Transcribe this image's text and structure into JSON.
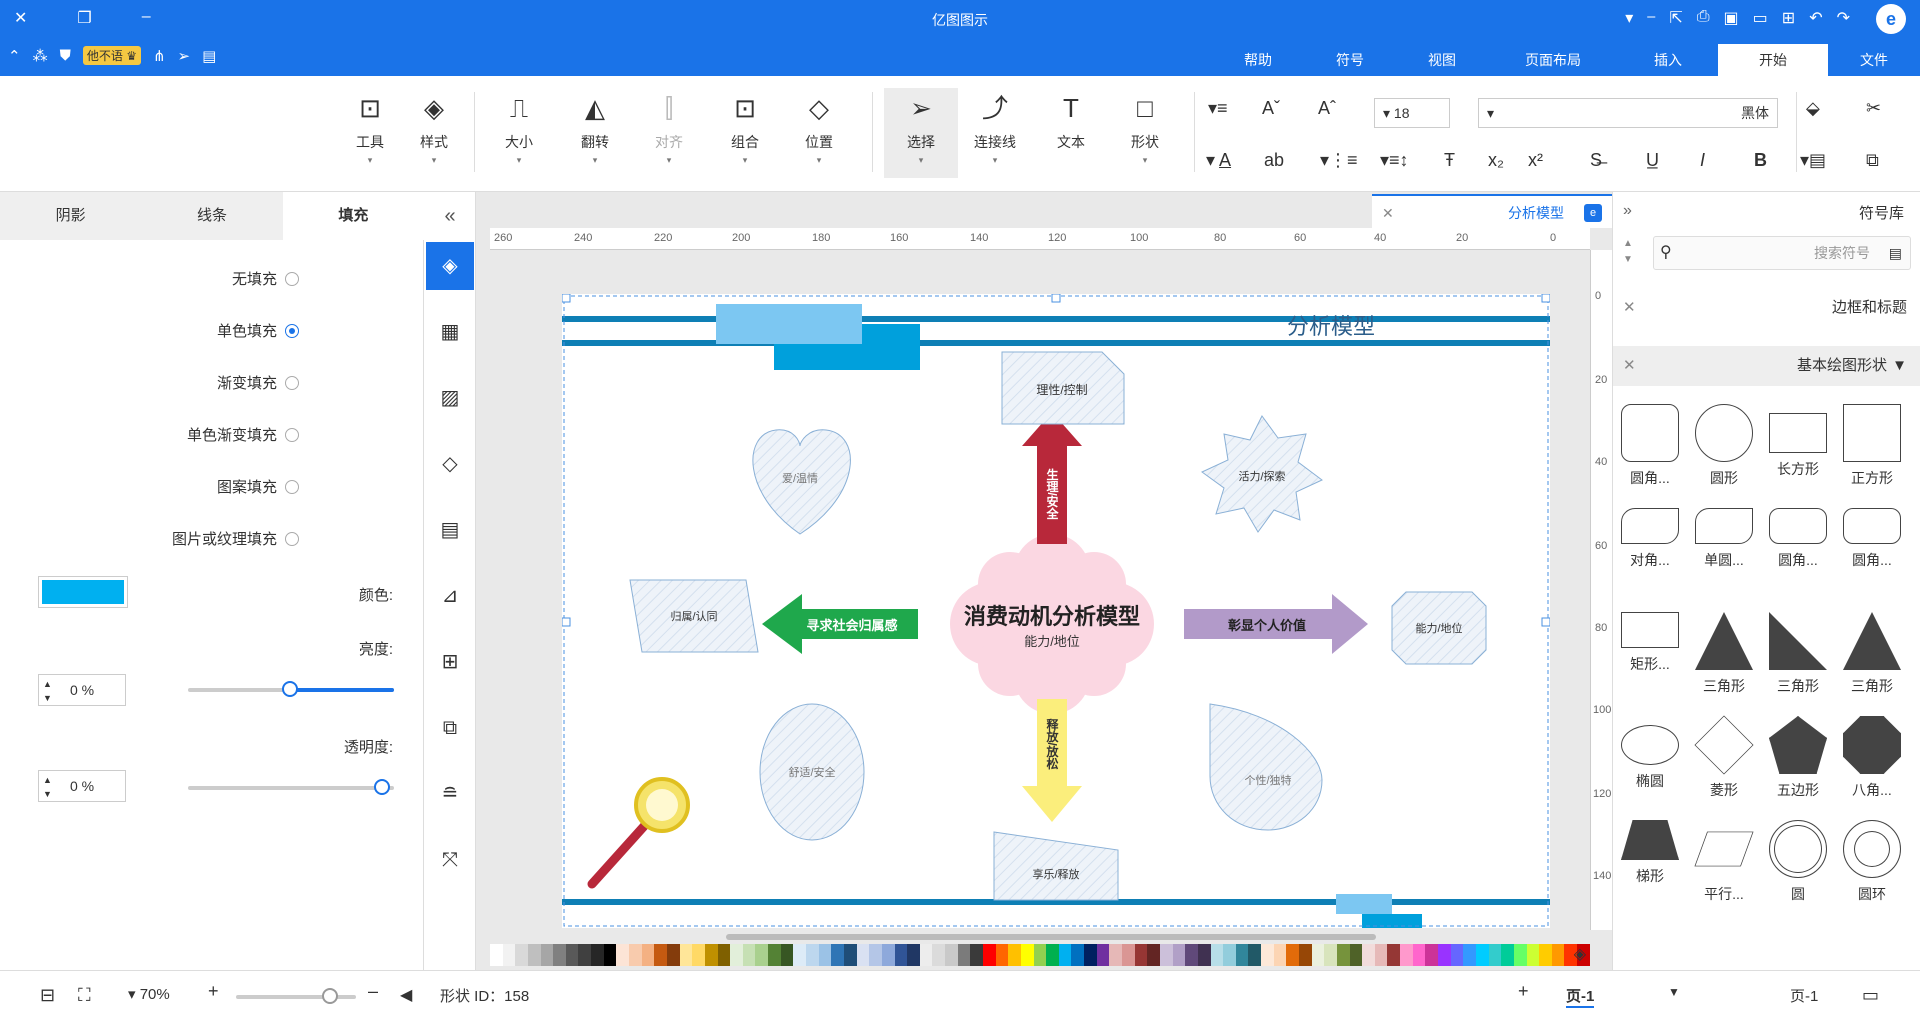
{
  "app": {
    "title": "亿图图示"
  },
  "quickaccess": {
    "user_label": "他不语"
  },
  "menu": {
    "tabs": [
      "文件",
      "开始",
      "插入",
      "页面布局",
      "视图",
      "符号",
      "帮助"
    ],
    "active": "开始"
  },
  "ribbon": {
    "buttons": {
      "tools": "工具",
      "style": "样式",
      "size": "大小",
      "flip": "翻转",
      "align": "对齐",
      "group": "组合",
      "position": "位置",
      "select": "选择",
      "connector": "连接线",
      "text": "文本",
      "shape": "形状"
    },
    "font_size": "18",
    "font_name": "黑体"
  },
  "left_panel": {
    "tabs": [
      "填充",
      "线条",
      "阴影"
    ],
    "active_tab": "填充",
    "fill_options": [
      "无填充",
      "单色填充",
      "渐变填充",
      "单色渐变填充",
      "图案填充",
      "图片或纹理填充"
    ],
    "selected_fill": "单色填充",
    "color_label": "颜色:",
    "fill_color": "#00b0f0",
    "brightness_label": "亮度:",
    "brightness_value": "0 %",
    "transparency_label": "透明度:",
    "transparency_value": "0 %"
  },
  "document": {
    "tab_title": "分析模型"
  },
  "diagram": {
    "title": "分析模型",
    "center_title": "消费动机分析模型",
    "center_sub": "能力/地位",
    "arrow_up": "生理/安全",
    "arrow_left": "寻求社会归属感",
    "arrow_right": "彰显个人价值",
    "arrow_down": "释放/放松",
    "top_box": "理性/控制",
    "heart": "爱/温情",
    "star": "活力/探索",
    "parallelogram": "归属/认同",
    "octagon": "能力/地位",
    "egg": "舒适/安全",
    "drop": "个性/独特",
    "trapezoid": "享乐/释放"
  },
  "ruler": {
    "h_ticks": [
      "260",
      "240",
      "220",
      "200",
      "180",
      "160",
      "140",
      "120",
      "100",
      "80",
      "60",
      "40",
      "20",
      "0"
    ],
    "v_ticks": [
      "0",
      "20",
      "40",
      "60",
      "80",
      "100",
      "120",
      "140"
    ]
  },
  "palette": [
    "#ffffff",
    "#f2f2f2",
    "#d9d9d9",
    "#bfbfbf",
    "#a6a6a6",
    "#808080",
    "#595959",
    "#404040",
    "#262626",
    "#000000",
    "#fce4d6",
    "#f8cbad",
    "#f4b183",
    "#c55a11",
    "#843c0c",
    "#ffe699",
    "#ffd966",
    "#bf9000",
    "#7f6000",
    "#e2efda",
    "#c6e0b4",
    "#a9d08e",
    "#548235",
    "#375623",
    "#ddebf7",
    "#bdd7ee",
    "#9bc2e6",
    "#2f75b5",
    "#1f4e78",
    "#d9e1f2",
    "#b4c6e7",
    "#8ea9db",
    "#305496",
    "#203764",
    "#ededed",
    "#dbdbdb",
    "#c9c9c9",
    "#7b7b7b",
    "#3a3a3a",
    "#ff0000",
    "#ff6600",
    "#ffc000",
    "#ffff00",
    "#92d050",
    "#00b050",
    "#00b0f0",
    "#0070c0",
    "#002060",
    "#7030a0",
    "#e6b8b7",
    "#da9694",
    "#963634",
    "#632523",
    "#ccc0da",
    "#b1a0c7",
    "#60497a",
    "#403151",
    "#b7dee8",
    "#92cddc",
    "#31869b",
    "#215967",
    "#fde9d9",
    "#fcd5b4",
    "#e26b0a",
    "#974706",
    "#ebf1de",
    "#d8e4bc",
    "#76933c",
    "#4f6228",
    "#f2dcdb",
    "#e6b9b8",
    "#953735",
    "#ff99cc",
    "#ff66cc",
    "#cc3399",
    "#9933ff",
    "#6666ff",
    "#3399ff",
    "#00ccff",
    "#33cccc",
    "#00cc99",
    "#66ff66",
    "#ccff33",
    "#ffcc00",
    "#ff9900",
    "#ff3300",
    "#cc0000"
  ],
  "right_panel": {
    "title": "符号库",
    "search_placeholder": "搜索符号",
    "lib1": "边框和标题",
    "lib2": "基本绘图形状",
    "shapes": [
      "正方形",
      "长方形",
      "圆形",
      "圆角...",
      "圆角...",
      "圆角...",
      "单圆...",
      "对角...",
      "三角形",
      "三角形",
      "三角形",
      "矩形...",
      "八角...",
      "五边形",
      "菱形",
      "椭圆",
      "圆环",
      "圆",
      "平行...",
      "梯形"
    ]
  },
  "status": {
    "page_left": "页-1",
    "page_tab": "页-1",
    "add_page": "+",
    "shape_id": "形状 ID：158",
    "zoom": "70%"
  }
}
